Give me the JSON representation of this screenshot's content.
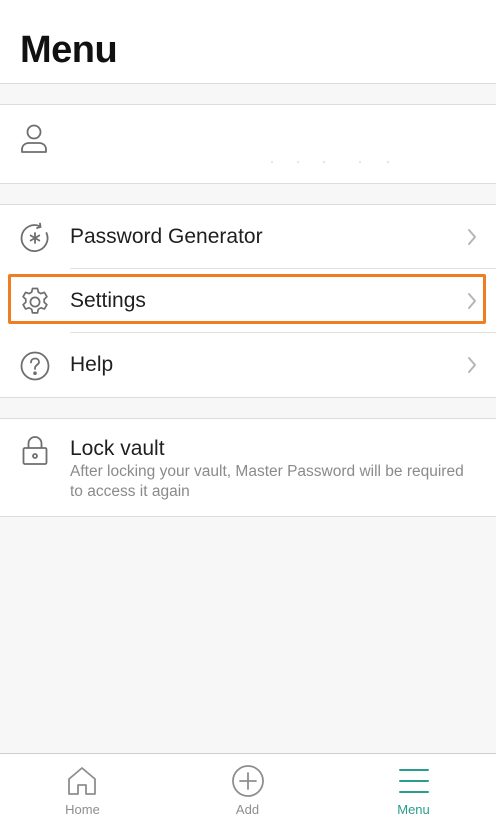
{
  "header": {
    "title": "Menu"
  },
  "account": {
    "icon": "user-icon"
  },
  "nav": {
    "items": [
      {
        "label": "Password Generator",
        "icon": "password-generator-icon"
      },
      {
        "label": "Settings",
        "icon": "gear-icon"
      },
      {
        "label": "Help",
        "icon": "help-icon"
      }
    ]
  },
  "lock": {
    "title": "Lock vault",
    "description": "After locking your vault, Master Password will be required to access it again",
    "icon": "lock-icon"
  },
  "tabbar": {
    "tabs": [
      {
        "label": "Home",
        "icon": "home-icon"
      },
      {
        "label": "Add",
        "icon": "add-icon"
      },
      {
        "label": "Menu",
        "icon": "menu-icon"
      }
    ],
    "active_tab": "Menu"
  },
  "colors": {
    "accent": "#2a9d8f",
    "highlight": "#ef7d22",
    "icon": "#6e6e6e"
  }
}
